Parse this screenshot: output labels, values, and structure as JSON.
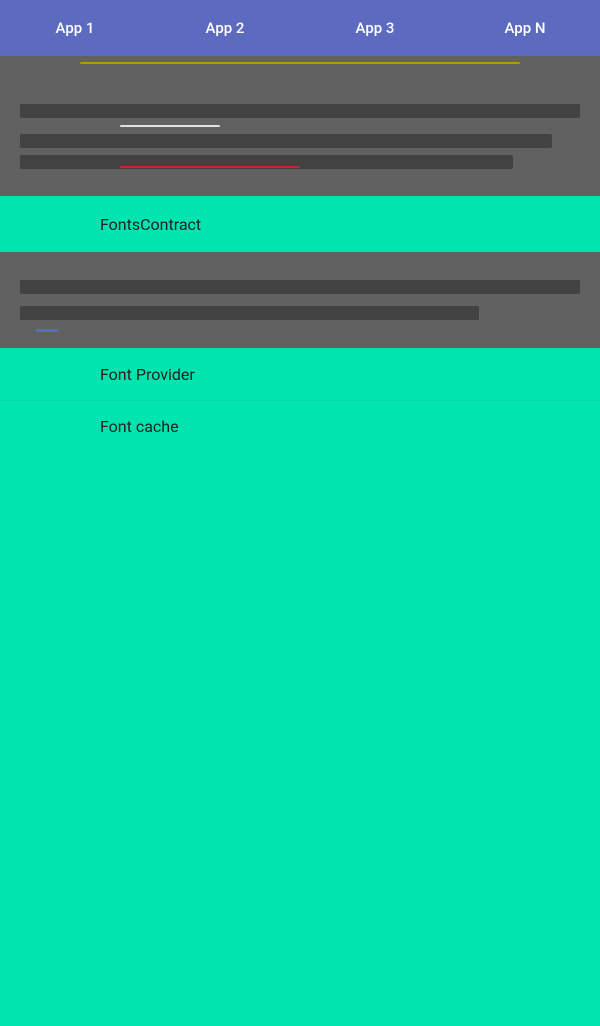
{
  "topbar": {
    "background": "#5c6bc0",
    "tabs": [
      {
        "label": "App 1"
      },
      {
        "label": "App 2"
      },
      {
        "label": "App 3"
      },
      {
        "label": "App N"
      }
    ]
  },
  "sections": {
    "fonts_contract": "FontsContract",
    "font_provider": "Font Provider",
    "font_cache": "Font cache"
  }
}
